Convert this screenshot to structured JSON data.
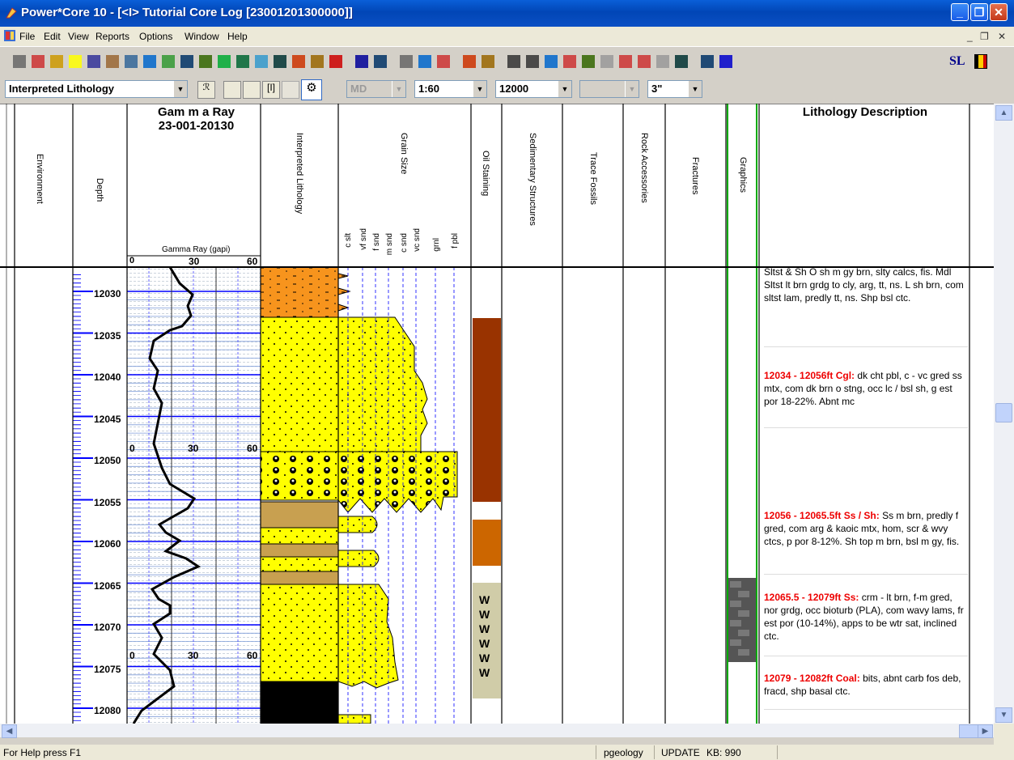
{
  "window": {
    "title": "Power*Core 10 - [<I> Tutorial Core Log [23001201300000]]"
  },
  "menu": [
    "File",
    "Edit",
    "View",
    "Reports",
    "Options",
    "Window",
    "Help"
  ],
  "toolbar": {
    "layout_combo": "Interpreted Lithology",
    "depth_ref": "MD",
    "scale": "1:60",
    "start_depth": "12000",
    "blank_combo": "",
    "width": "3\"",
    "sl_label": "SL"
  },
  "tracks": {
    "environment": "Environment",
    "depth": "Depth",
    "gamma_title": "Gam m a Ray",
    "gamma_well": "23-001-20130",
    "gamma_curve": "Gamma Ray (gapi)",
    "gamma_scale": [
      "0",
      "30",
      "60"
    ],
    "interpreted_lithology": "Interpreted Lithology",
    "grain_size": "Grain Size",
    "grain_classes": [
      "c slt",
      "vf snd",
      "f snd",
      "m snd",
      "c snd",
      "vc snd",
      "grnl",
      "f pbl"
    ],
    "oil_staining": "Oil Staining",
    "sedimentary_structures": "Sedimentary Structures",
    "trace_fossils": "Trace Fossils",
    "rock_accessories": "Rock Accessories",
    "fractures": "Fractures",
    "graphics": "Graphics",
    "lithology_description": "Lithology Description"
  },
  "depths": [
    "12030",
    "12035",
    "12040",
    "12045",
    "12050",
    "12055",
    "12060",
    "12065",
    "12070",
    "12075",
    "12080"
  ],
  "gamma_inline_scale": [
    "0",
    "30",
    "60"
  ],
  "oil_w_marks": [
    "W",
    "W",
    "W",
    "W",
    "W",
    "W"
  ],
  "descriptions": [
    {
      "head": "",
      "body": "Sltst & Sh O sh m gy brn, slty calcs, fis. Mdl Sltst lt brn grdg to cly, arg, tt, ns. L sh brn, com sltst lam, predly tt, ns. Shp bsl ctc."
    },
    {
      "head": "12034 - 12056ft Cgl:",
      "body": " dk cht pbl, c - vc gred ss mtx, com dk brn o stng, occ lc / bsl sh, g est por 18-22%. Abnt mc"
    },
    {
      "head": "12056 - 12065.5ft Ss / Sh:",
      "body": " Ss m brn, predly f gred, com arg & kaoic mtx, hom, scr & wvy ctcs, p por 8-12%. Sh top m brn, bsl m gy, fis."
    },
    {
      "head": "12065.5 - 12079ft Ss:",
      "body": " crm - lt brn, f-m gred, nor grdg, occ bioturb (PLA), com wavy lams, fr est por (10-14%), apps to be wtr sat, inclined ctc."
    },
    {
      "head": "12079 - 12082ft Coal:",
      "body": " bits, abnt carb fos deb, fracd, shp basal ctc."
    }
  ],
  "status": {
    "help": "For Help press F1",
    "user": "pgeology",
    "mode": "UPDATE",
    "kb": "KB: 990"
  },
  "colors": {
    "title_blue": "#0a5fd8",
    "sand_yellow": "#ffff00",
    "silt_orange": "#f7941d",
    "oil_dark_brown": "#993300",
    "oil_orange": "#cc6600",
    "water_sat": "#d0cca8",
    "shale_tan": "#c8a050",
    "coal_black": "#000000",
    "desc_head_red": "#e00000",
    "depth_grid_blue": "#0000ff"
  }
}
